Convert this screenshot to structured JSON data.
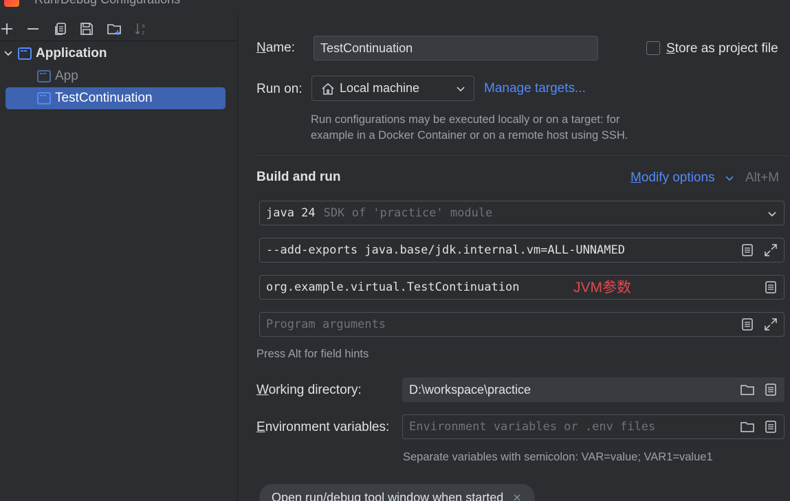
{
  "window": {
    "title": "Run/Debug Configurations"
  },
  "toolbar": {
    "add": "add-icon",
    "remove": "remove-icon",
    "copy": "copy-icon",
    "save": "save-icon",
    "folder": "new-folder-icon",
    "sort": "sort-alpha-icon"
  },
  "tree": {
    "group_label": "Application",
    "items": [
      {
        "label": "App"
      },
      {
        "label": "TestContinuation"
      }
    ]
  },
  "form": {
    "name_label_u": "N",
    "name_label_rest": "ame:",
    "name_value": "TestContinuation",
    "store_label_u": "S",
    "store_label_rest": "tore as project file",
    "run_on_label": "Run on:",
    "run_on_value": "Local machine",
    "manage_targets": "Manage targets...",
    "run_on_help_1": "Run configurations may be executed locally or on a target: for",
    "run_on_help_2": "example in a Docker Container or on a remote host using SSH.",
    "build_run_heading": "Build and run",
    "modify_u": "M",
    "modify_rest": "odify options",
    "modify_shortcut": "Alt+M",
    "sdk_main": "java 24",
    "sdk_hint": "SDK of 'practice' module",
    "vm_options": "--add-exports java.base/jdk.internal.vm=ALL-UNNAMED",
    "main_class": "org.example.virtual.TestContinuation",
    "annotation": "JVM参数",
    "program_args_placeholder": "Program arguments",
    "field_hint": "Press Alt for field hints",
    "workdir_label_u": "W",
    "workdir_label_rest": "orking directory:",
    "workdir_value": "D:\\workspace\\practice",
    "env_label_u": "E",
    "env_label_rest": "nvironment variables:",
    "env_placeholder": "Environment variables or .env files",
    "env_help": "Separate variables with semicolon: VAR=value; VAR1=value1",
    "option_pill": "Open run/debug tool window when started"
  },
  "colors": {
    "accent": "#548af7",
    "selection": "#3e63b0",
    "annotation": "#e5484d"
  }
}
